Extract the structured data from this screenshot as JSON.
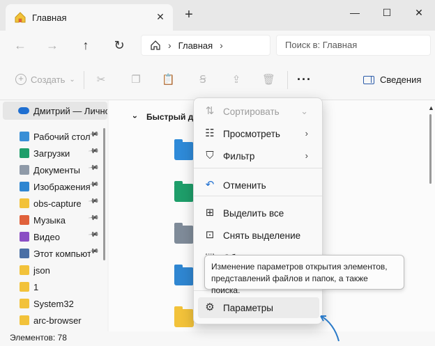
{
  "tab": {
    "title": "Главная",
    "close": "✕",
    "new_tab": "+"
  },
  "window": {
    "minimize": "—",
    "maximize": "☐",
    "close": "✕"
  },
  "address": {
    "crumb": "Главная",
    "search_placeholder": "Поиск в: Главная"
  },
  "commandbar": {
    "create_label": "Создать",
    "more": "···",
    "details_label": "Сведения"
  },
  "sidebar": {
    "user": "Дмитрий — Личное",
    "items": [
      {
        "label": "Рабочий стол",
        "color": "#3a8fd6",
        "pinned": true
      },
      {
        "label": "Загрузки",
        "color": "#1e9e6a",
        "pinned": true
      },
      {
        "label": "Документы",
        "color": "#8f9aa8",
        "pinned": true
      },
      {
        "label": "Изображения",
        "color": "#2f86d1",
        "pinned": true
      },
      {
        "label": "obs-capture",
        "color": "#f2c23a",
        "pinned": true
      },
      {
        "label": "Музыка",
        "color": "#e0613b",
        "pinned": true
      },
      {
        "label": "Видео",
        "color": "#8b4fc4",
        "pinned": true
      },
      {
        "label": "Этот компьютер",
        "color": "#4a6fa5",
        "pinned": true
      },
      {
        "label": "json",
        "color": "#f2c23a",
        "pinned": false
      },
      {
        "label": "1",
        "color": "#f2c23a",
        "pinned": false
      },
      {
        "label": "System32",
        "color": "#f2c23a",
        "pinned": false
      },
      {
        "label": "arc-browser",
        "color": "#f2c23a",
        "pinned": false
      }
    ]
  },
  "content": {
    "group_title": "Быстрый доступ",
    "folders": [
      {
        "color": "#2e8ad8"
      },
      {
        "color": "#1e9e6a"
      },
      {
        "color": "#7f8b99"
      },
      {
        "color": "#2f86d1"
      },
      {
        "color": "#f2c23a"
      }
    ]
  },
  "menu": {
    "items": [
      {
        "label": "Сортировать",
        "disabled": true,
        "submenu": true,
        "icon": "sort-icon"
      },
      {
        "label": "Просмотреть",
        "disabled": false,
        "submenu": true,
        "icon": "view-icon"
      },
      {
        "label": "Фильтр",
        "disabled": false,
        "submenu": true,
        "icon": "filter-icon"
      },
      {
        "label": "Отменить",
        "disabled": false,
        "submenu": false,
        "icon": "undo-icon"
      },
      {
        "label": "Выделить все",
        "disabled": false,
        "submenu": false,
        "icon": "select-all-icon"
      },
      {
        "label": "Снять выделение",
        "disabled": false,
        "submenu": false,
        "icon": "select-none-icon"
      },
      {
        "label": "Обратить выделение",
        "disabled": false,
        "submenu": false,
        "icon": "invert-selection-icon"
      },
      {
        "label": "Параметры",
        "disabled": false,
        "submenu": false,
        "icon": "gear-icon"
      }
    ]
  },
  "tooltip": {
    "text": "Изменение параметров открытия элементов, представлений файлов и папок, а также поиска."
  },
  "status": {
    "text": "Элементов: 78"
  },
  "colors": {
    "accent": "#1f6fd1",
    "annotation": "#2a7ac8"
  }
}
